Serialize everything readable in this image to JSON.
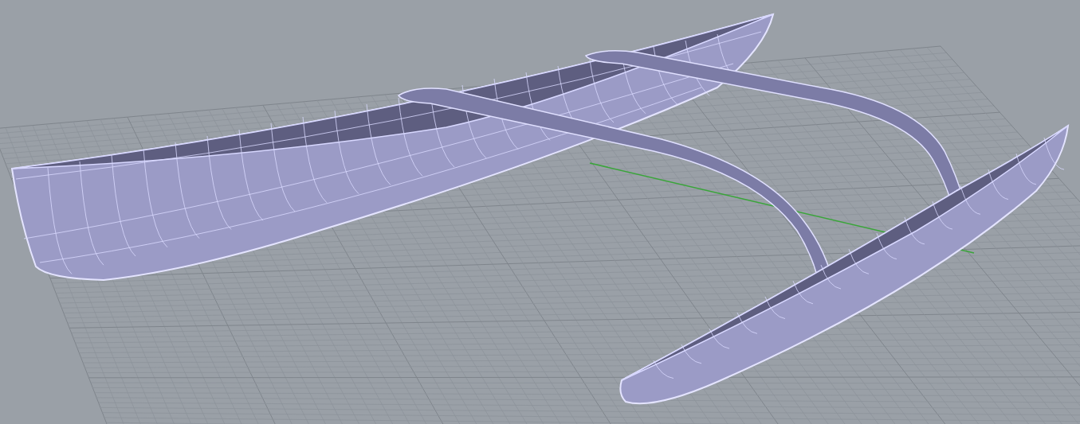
{
  "viewport": {
    "grid": true,
    "axis": true,
    "model": true
  }
}
